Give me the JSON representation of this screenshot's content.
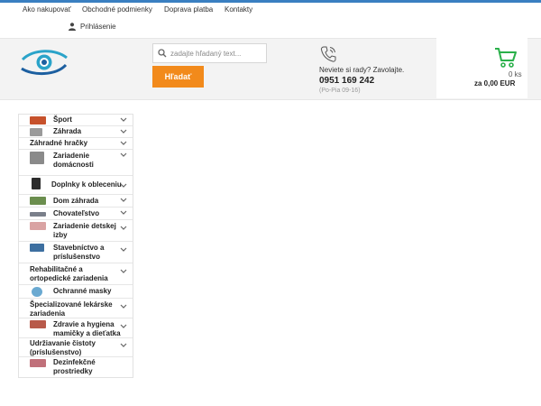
{
  "colors": {
    "accent_blue": "#3a7fc1",
    "brand_teal": "#2aa3c9",
    "search_button": "#f28a1b",
    "cart_icon": "#2ab04a",
    "header_bg": "#f3f3f3"
  },
  "top_nav": [
    {
      "label": "Ako nakupovať"
    },
    {
      "label": "Obchodné podmienky"
    },
    {
      "label": "Doprava platba"
    },
    {
      "label": "Kontakty"
    }
  ],
  "login": {
    "label": "Prihlásenie",
    "icon": "user-icon"
  },
  "logo": {
    "icon": "eye-logo-icon"
  },
  "search": {
    "placeholder": "zadajte hľadaný text...",
    "value": "",
    "button_label": "Hľadať",
    "icon": "search-icon"
  },
  "contact": {
    "prompt": "Neviete si rady? Zavolajte.",
    "phone": "0951 169 242",
    "hours": "(Po-Pia 09-16)",
    "icon": "phone-icon"
  },
  "cart": {
    "count": "0 ks",
    "total": "za 0,00 EUR",
    "icon": "cart-icon"
  },
  "menu": {
    "items": [
      {
        "label": "Šport",
        "thumb_color": "#c6512b"
      },
      {
        "label": "Záhrada",
        "thumb_color": "#9a9a9a"
      },
      {
        "label": "Záhradné hračky",
        "thumb_color": ""
      },
      {
        "label": "Zariadenie domácnosti",
        "thumb_color": "#8a8a8a"
      },
      {
        "label": "Doplnky k obleceniu",
        "thumb_color": "#2c2c2c"
      },
      {
        "label": "Dom záhrada",
        "thumb_color": "#6b8e4e"
      },
      {
        "label": "Chovateľstvo",
        "thumb_color": "#7a7f8a"
      },
      {
        "label": "Zariadenie detskej izby",
        "thumb_color": "#d9a3a3"
      },
      {
        "label": "Stavebníctvo a príslušenstvo",
        "thumb_color": "#3d6fa0"
      },
      {
        "label": "Rehabilitačné a ortopedické zariadenia",
        "thumb_color": ""
      },
      {
        "label": "Ochranné masky",
        "thumb_color": "#6aa9d1"
      },
      {
        "label": "Špecializované lekárske zariadenia",
        "thumb_color": ""
      },
      {
        "label": "Zdravie a hygiena mamičky a dieťatka",
        "thumb_color": "#b85a4a"
      },
      {
        "label": "Udržiavanie čistoty (príslušenstvo)",
        "thumb_color": ""
      },
      {
        "label": "Dezinfekčné prostriedky",
        "thumb_color": "#c0707a"
      }
    ]
  }
}
